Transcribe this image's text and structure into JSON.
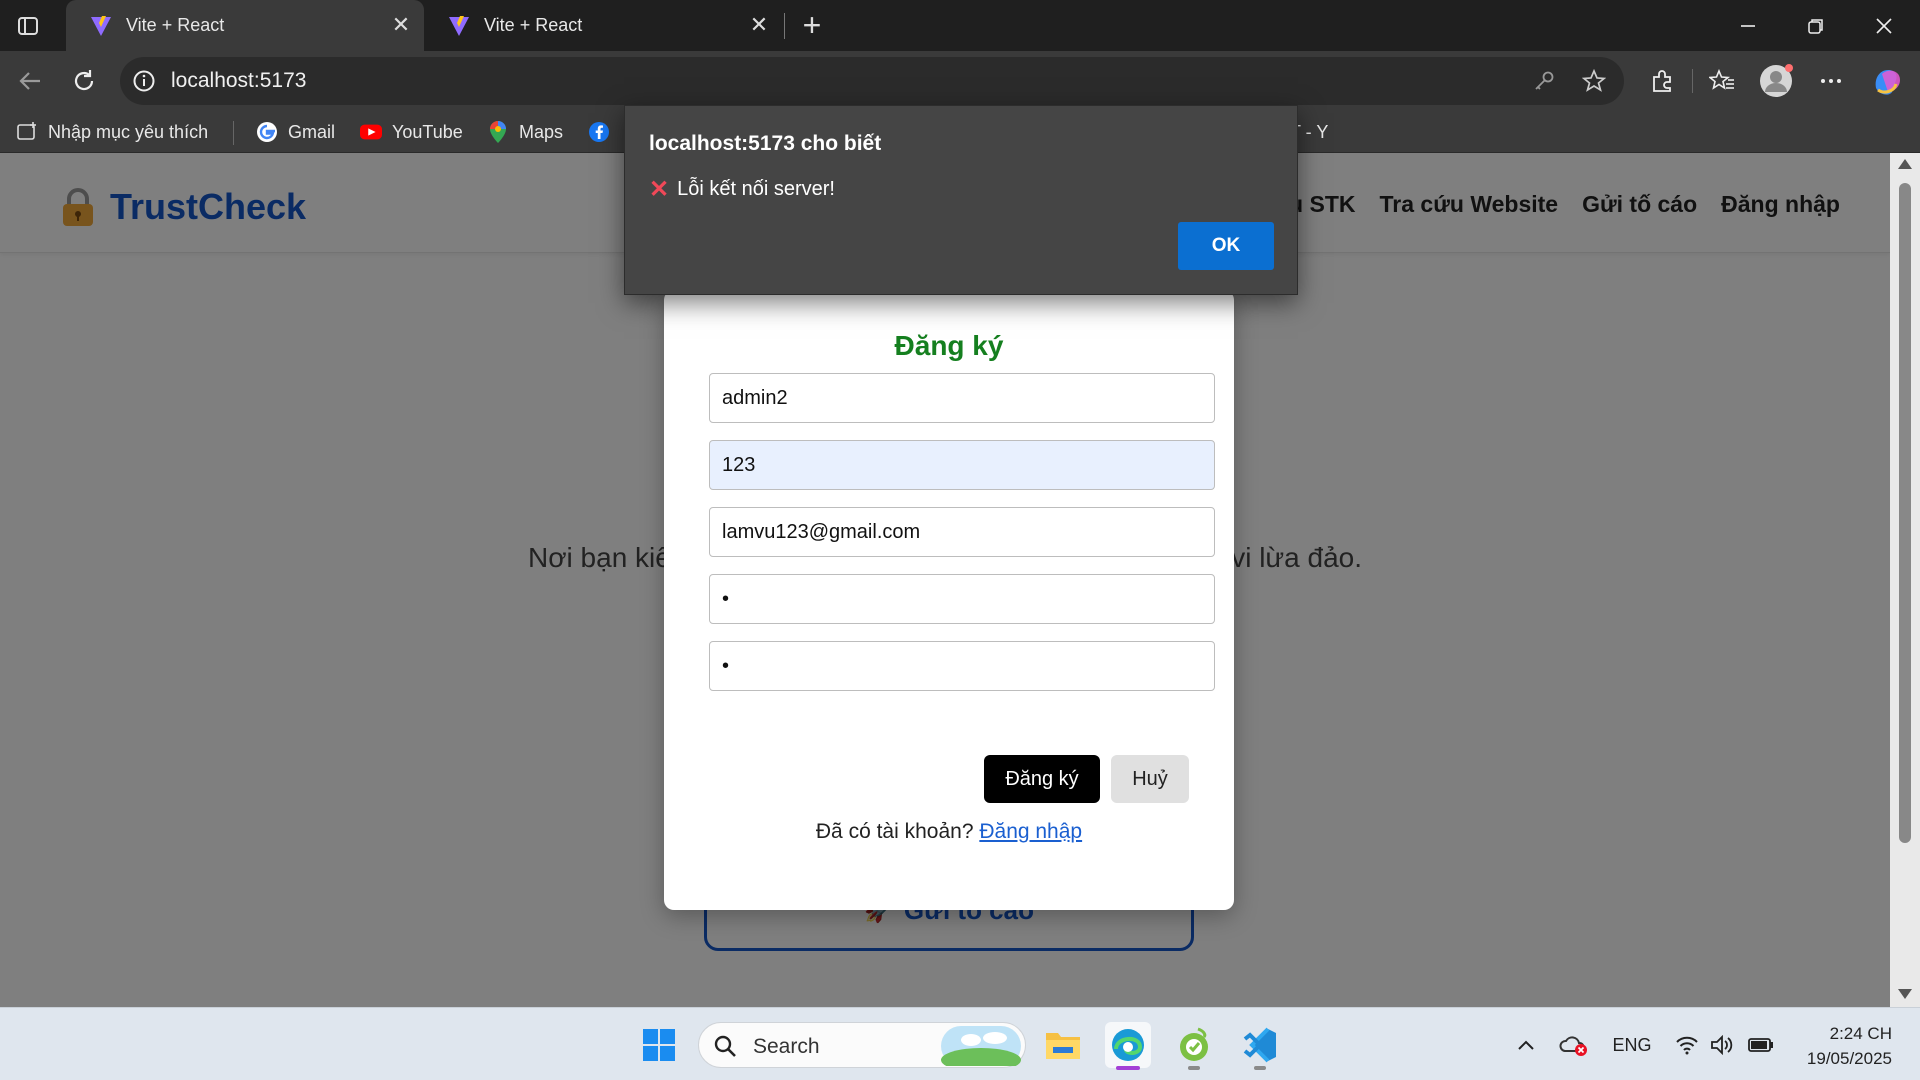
{
  "browser": {
    "tabs": [
      {
        "title": "Vite + React",
        "active": true
      },
      {
        "title": "Vite + React",
        "active": false
      }
    ],
    "url": "localhost:5173",
    "bookmarks": [
      {
        "label": "Nhập mục yêu thích",
        "icon": "bookmark-add-icon"
      },
      {
        "label": "Gmail",
        "icon": "google-icon"
      },
      {
        "label": "YouTube",
        "icon": "youtube-icon"
      },
      {
        "label": "Maps",
        "icon": "maps-icon"
      },
      {
        "label": "T - Y",
        "icon": "facebook-icon"
      }
    ]
  },
  "site": {
    "brand": "TrustCheck",
    "nav": [
      "Tra cứu STK",
      "Tra cứu Website",
      "Gửi tố cáo",
      "Đăng nhập"
    ],
    "hero_text": "Nơi bạn kiểm tra thông tin, cảnh báo và tố cáo các hành vi lừa đảo.",
    "report_button": "Gửi tố cáo"
  },
  "modal": {
    "title": "Đăng ký",
    "fields": [
      {
        "value": "admin2",
        "type": "text"
      },
      {
        "value": "123",
        "type": "text"
      },
      {
        "value": "lamvu123@gmail.com",
        "type": "text"
      },
      {
        "value": "1",
        "type": "password"
      },
      {
        "value": "1",
        "type": "password"
      }
    ],
    "submit_label": "Đăng ký",
    "cancel_label": "Huỷ",
    "have_account_text": "Đã có tài khoản?",
    "login_link": "Đăng nhập"
  },
  "alert": {
    "title": "localhost:5173 cho biết",
    "message": "Lỗi kết nối server!",
    "ok_label": "OK"
  },
  "taskbar": {
    "search_placeholder": "Search",
    "language": "ENG",
    "time": "2:24 CH",
    "date": "19/05/2025"
  },
  "colors": {
    "brand": "#1456c8",
    "modal_title": "#157f1f",
    "alert_ok": "#0b6fd1"
  }
}
